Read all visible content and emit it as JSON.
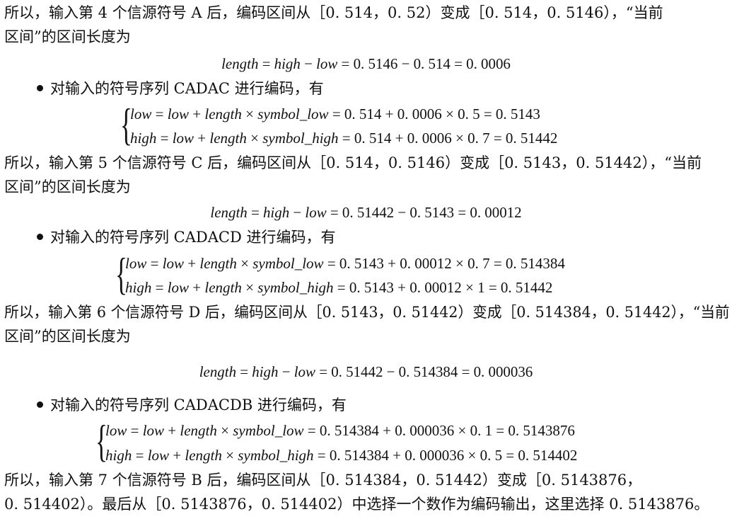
{
  "para1": {
    "line1": "所以，输入第 4 个信源符号 A 后，编码区间从［0. 514，0. 52）变成［0. 514，0. 5146），“当前",
    "line2": "区间”的区间长度为",
    "formula": "length = high − low = 0. 5146 − 0. 514 = 0. 0006"
  },
  "step5": {
    "bullet": "对输入的符号序列 CADAC 进行编码，有",
    "low_eq": "low = low + length × symbol_low = 0. 514 + 0. 0006 × 0. 5 = 0. 5143",
    "high_eq": "high = low + length × symbol_high = 0. 514 + 0. 0006 × 0. 7 = 0. 51442",
    "line1": "所以，输入第 5 个信源符号 C 后，编码区间从［0. 514，0. 5146）变成［0. 5143，0. 51442），“当前",
    "line2": "区间”的区间长度为",
    "formula": "length = high − low = 0. 51442 − 0. 5143 = 0. 00012"
  },
  "step6": {
    "bullet": "对输入的符号序列 CADACD 进行编码，有",
    "low_eq": "low = low + length × symbol_low = 0. 5143 + 0. 00012 × 0. 7 = 0. 514384",
    "high_eq": "high = low + length × symbol_high = 0. 5143 + 0. 00012 × 1 = 0. 51442",
    "line1": "所以，输入第 6 个信源符号 D 后，编码区间从［0. 5143，0. 51442）变成［0. 514384，0. 51442），“当前",
    "line2": "区间”的区间长度为",
    "formula": "length = high − low = 0. 51442 − 0. 514384 = 0. 000036"
  },
  "step7": {
    "bullet": "对输入的符号序列 CADACDB 进行编码，有",
    "low_eq": "low = low + length × symbol_low = 0. 514384 + 0. 000036 × 0. 1 = 0. 5143876",
    "high_eq": "high = low + length × symbol_high = 0. 514384 + 0. 000036 × 0. 5 = 0. 514402",
    "line1": "所以，输入第 7 个信源符号 B 后，编码区间从［0. 514384，0. 51442）变成［0. 5143876，",
    "line2": "0. 514402）。最后从［0. 5143876，0. 514402）中选择一个数作为编码输出，这里选择 0. 5143876。"
  }
}
